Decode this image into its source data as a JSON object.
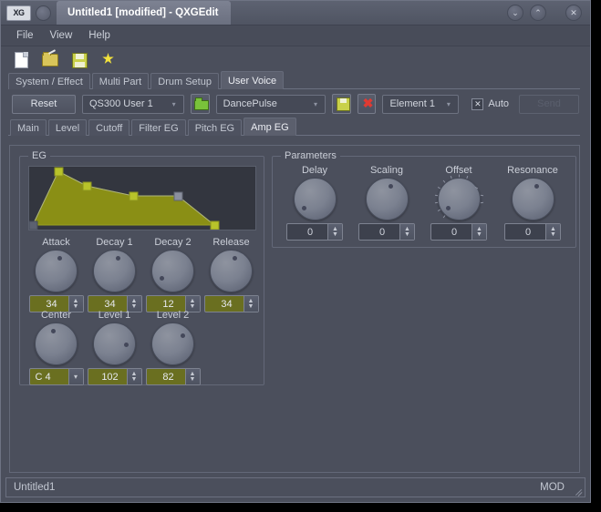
{
  "window": {
    "logo": "XG",
    "title": "Untitled1 [modified] - QXGEdit",
    "buttons": {
      "minimize": "⌄",
      "maximize": "⌃",
      "close": "✕"
    }
  },
  "menubar": {
    "items": [
      "File",
      "View",
      "Help"
    ]
  },
  "toolbar": {
    "items": [
      {
        "name": "new-file-icon",
        "label": "New"
      },
      {
        "name": "open-file-icon",
        "label": "Open"
      },
      {
        "name": "save-file-icon",
        "label": "Save"
      },
      {
        "name": "star-icon",
        "label": "Master"
      }
    ]
  },
  "main_tabs": {
    "items": [
      "System / Effect",
      "Multi Part",
      "Drum Setup",
      "User Voice"
    ],
    "active": "User Voice"
  },
  "controls": {
    "reset_label": "Reset",
    "bank_value": "QS300 User 1",
    "folder_icon": "folder-icon",
    "voice_value": "DancePulse",
    "save_icon": "save-icon",
    "delete_icon": "delete-icon",
    "element_value": "Element 1",
    "auto_label": "Auto",
    "auto_checked": "✕",
    "send_label": "Send"
  },
  "param_tabs": {
    "items": [
      "Main",
      "Level",
      "Cutoff",
      "Filter EG",
      "Pitch EG",
      "Amp EG"
    ],
    "active": "Amp EG"
  },
  "eg": {
    "group_title": "EG",
    "knobs_row1": [
      {
        "label": "Attack",
        "value": "34"
      },
      {
        "label": "Decay 1",
        "value": "34"
      },
      {
        "label": "Decay 2",
        "value": "12"
      },
      {
        "label": "Release",
        "value": "34"
      }
    ],
    "knobs_row2": [
      {
        "label": "Center",
        "value": "C  4"
      },
      {
        "label": "Level 1",
        "value": "102"
      },
      {
        "label": "Level 2",
        "value": "82"
      }
    ]
  },
  "parameters": {
    "group_title": "Parameters",
    "knobs": [
      {
        "label": "Delay",
        "value": "0"
      },
      {
        "label": "Scaling",
        "value": "0"
      },
      {
        "label": "Offset",
        "value": "0"
      },
      {
        "label": "Resonance",
        "value": "0"
      }
    ]
  },
  "statusbar": {
    "left": "Untitled1",
    "right": "MOD"
  },
  "colors": {
    "window_bg": "#4b4f5c",
    "titlebar": "#5d6271",
    "envelope_fill": "#8a8f15",
    "envelope_handle": "#b8c32a",
    "spin_field": "#6a6f20",
    "accent_green": "#79c23a"
  },
  "chart_data": {
    "type": "line",
    "title": "EG",
    "xlabel": "",
    "ylabel": "",
    "grid": false,
    "legend": "none",
    "xlim": [
      0,
      100
    ],
    "ylim": [
      0,
      100
    ],
    "series": [
      {
        "name": "Amp EG envelope",
        "points": [
          {
            "x": 0,
            "y": 0,
            "handle": "start"
          },
          {
            "x": 13,
            "y": 100,
            "handle": "attack"
          },
          {
            "x": 26,
            "y": 78,
            "handle": "decay1"
          },
          {
            "x": 46,
            "y": 64,
            "handle": "decay2"
          },
          {
            "x": 64,
            "y": 64,
            "handle": "sustain"
          },
          {
            "x": 80,
            "y": 0,
            "handle": "release"
          }
        ]
      }
    ]
  }
}
